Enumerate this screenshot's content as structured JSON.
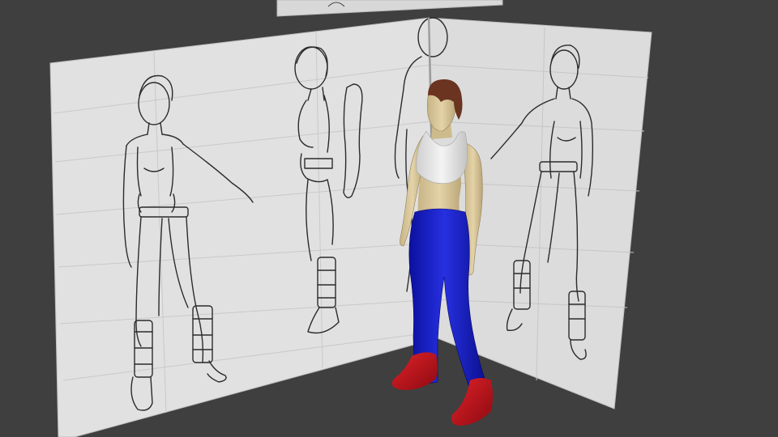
{
  "viewport": {
    "scene": "3d-viewport",
    "background_color": "#3f3f3f",
    "panel_color": "#e1e1e1",
    "panel_edge_color": "#bdbdbd",
    "sketch_line_color": "#2b2b2b",
    "model_colors": {
      "skin": "#d9c79a",
      "hair": "#6a3420",
      "top": "#e6e6e6",
      "pants": "#1c22c8",
      "boots": "#c0121a"
    }
  }
}
